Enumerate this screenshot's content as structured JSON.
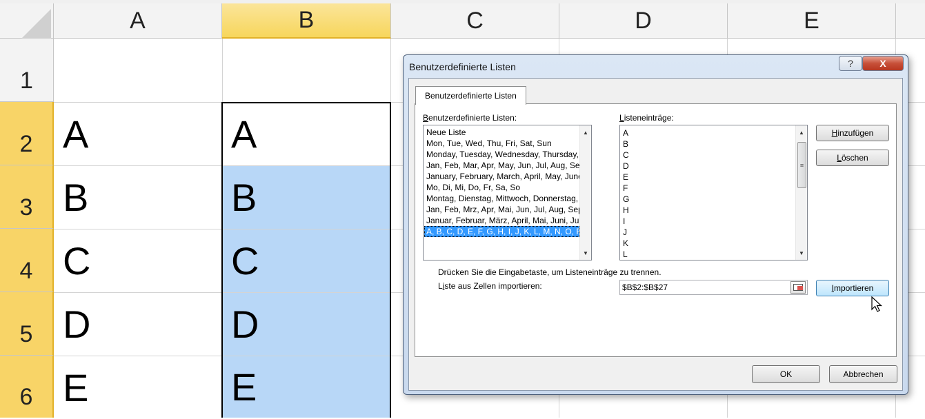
{
  "sheet": {
    "columns": [
      "A",
      "B",
      "C",
      "D",
      "E"
    ],
    "rows": [
      "1",
      "2",
      "3",
      "4",
      "5",
      "6"
    ],
    "col_a": [
      "",
      "A",
      "B",
      "C",
      "D",
      "E"
    ],
    "col_b": [
      "",
      "A",
      "B",
      "C",
      "D",
      "E"
    ]
  },
  "dialog": {
    "title": "Benutzerdefinierte Listen",
    "help_label": "?",
    "close_label": "X",
    "tab_label": "Benutzerdefinierte Listen",
    "lists_label_u": "B",
    "lists_label_rest": "enutzerdefinierte Listen:",
    "entries_label_u": "L",
    "entries_label_rest": "isteneinträge:",
    "custom_lists": [
      "Neue Liste",
      "Mon, Tue, Wed, Thu, Fri, Sat, Sun",
      "Monday, Tuesday, Wednesday, Thursday, F",
      "Jan, Feb, Mar, Apr, May, Jun, Jul, Aug, Sep",
      "January, February, March, April, May, June",
      "Mo, Di, Mi, Do, Fr, Sa, So",
      "Montag, Dienstag, Mittwoch, Donnerstag, F",
      "Jan, Feb, Mrz, Apr, Mai, Jun, Jul, Aug, Sep,",
      "Januar, Februar, März, April, Mai, Juni, Juli",
      "A, B, C, D, E, F, G, H, I, J, K, L, M, N, O, P,"
    ],
    "selected_index": 9,
    "list_entries": [
      "A",
      "B",
      "C",
      "D",
      "E",
      "F",
      "G",
      "H",
      "I",
      "J",
      "K",
      "L"
    ],
    "add_u": "H",
    "add_rest": "inzufügen",
    "delete_u": "L",
    "delete_rest": "öschen",
    "hint": "Drücken Sie die Eingabetaste, um Listeneinträge zu trennen.",
    "import_label_pre": "L",
    "import_label_u": "i",
    "import_label_rest": "ste aus Zellen importieren:",
    "import_range": "$B$2:$B$27",
    "import_u": "I",
    "import_rest": "mportieren",
    "ok_label": "OK",
    "cancel_label": "Abbrechen"
  },
  "colors": {
    "selection": "#b8d7f7",
    "header_selected": "#f8d467",
    "list_highlight": "#3399ff"
  }
}
